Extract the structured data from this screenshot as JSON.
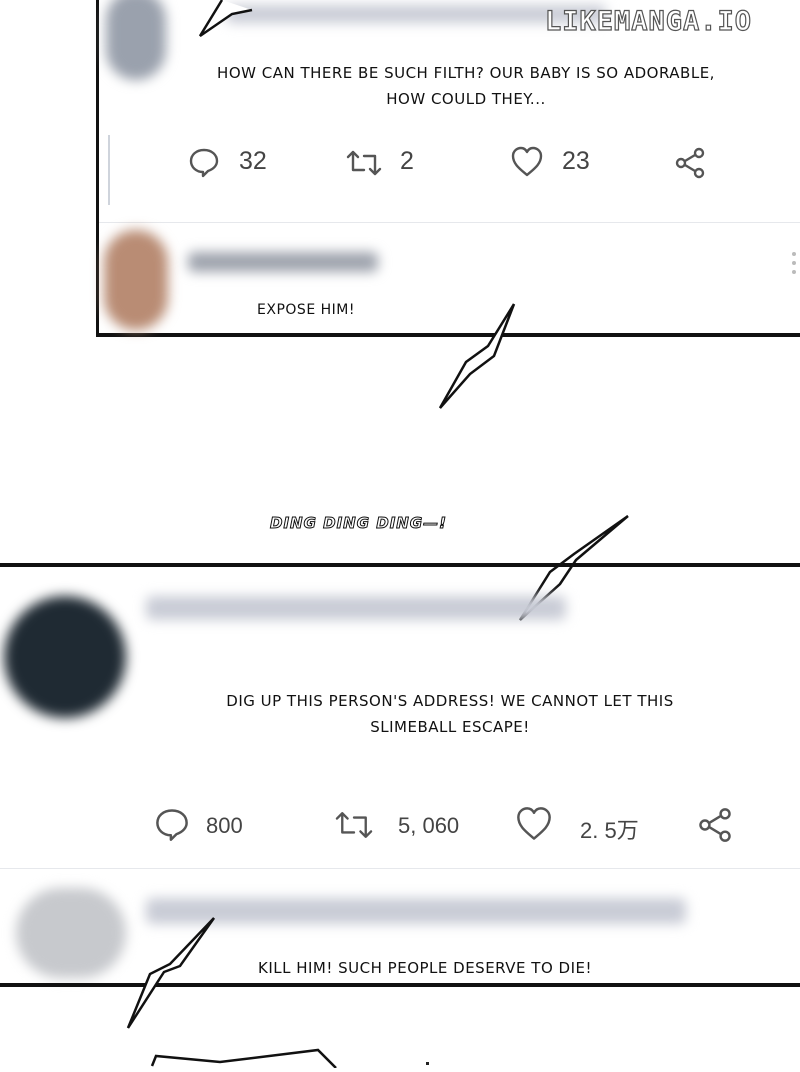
{
  "watermark": "LIKEMANGA.IO",
  "post1": {
    "text_line1": "HOW CAN THERE BE SUCH FILTH? OUR BABY IS SO ADORABLE,",
    "text_line2": "HOW COULD THEY...",
    "stats": {
      "comments": "32",
      "retweets": "2",
      "likes": "23"
    },
    "icons": [
      "comment-icon",
      "retweet-icon",
      "heart-icon",
      "share-icon"
    ]
  },
  "reply1": {
    "text": "EXPOSE HIM!"
  },
  "sfx": {
    "text": "DING DING DING—!"
  },
  "post2": {
    "text_line1": "DIG UP THIS PERSON'S ADDRESS! WE CANNOT LET THIS",
    "text_line2": "SLIMEBALL ESCAPE!",
    "stats": {
      "comments": "800",
      "retweets": "5, 060",
      "likes": "2. 5万"
    },
    "icons": [
      "comment-icon",
      "retweet-icon",
      "heart-icon",
      "share-icon"
    ]
  },
  "reply2": {
    "text": "KILL HIM! SUCH PEOPLE DESERVE TO DIE!"
  },
  "colors": {
    "panel_border": "#111111",
    "icon_gray": "#555555",
    "avatar_dark": "#1f2a33"
  }
}
